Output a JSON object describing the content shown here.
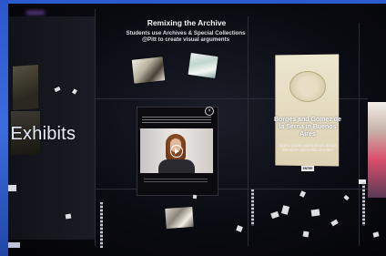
{
  "exhibits_label": "t Exhibits",
  "remix_panel": {
    "title": "Remixing the Archive",
    "subtitle": "Students use Archives & Special Collections @Pitt to create visual arguments"
  },
  "video_modal": {
    "close_symbol": "×",
    "play_icon": "play-icon"
  },
  "borges_panel": {
    "title": "Borges and Gómez de la Serna in Buenos Aires",
    "subtitle": "Guest guide explorations about literature and political exiles",
    "enter_label": "ENTER"
  },
  "colors": {
    "frame_blue": "#2a57c9",
    "wall_background": "#0a0b12"
  }
}
